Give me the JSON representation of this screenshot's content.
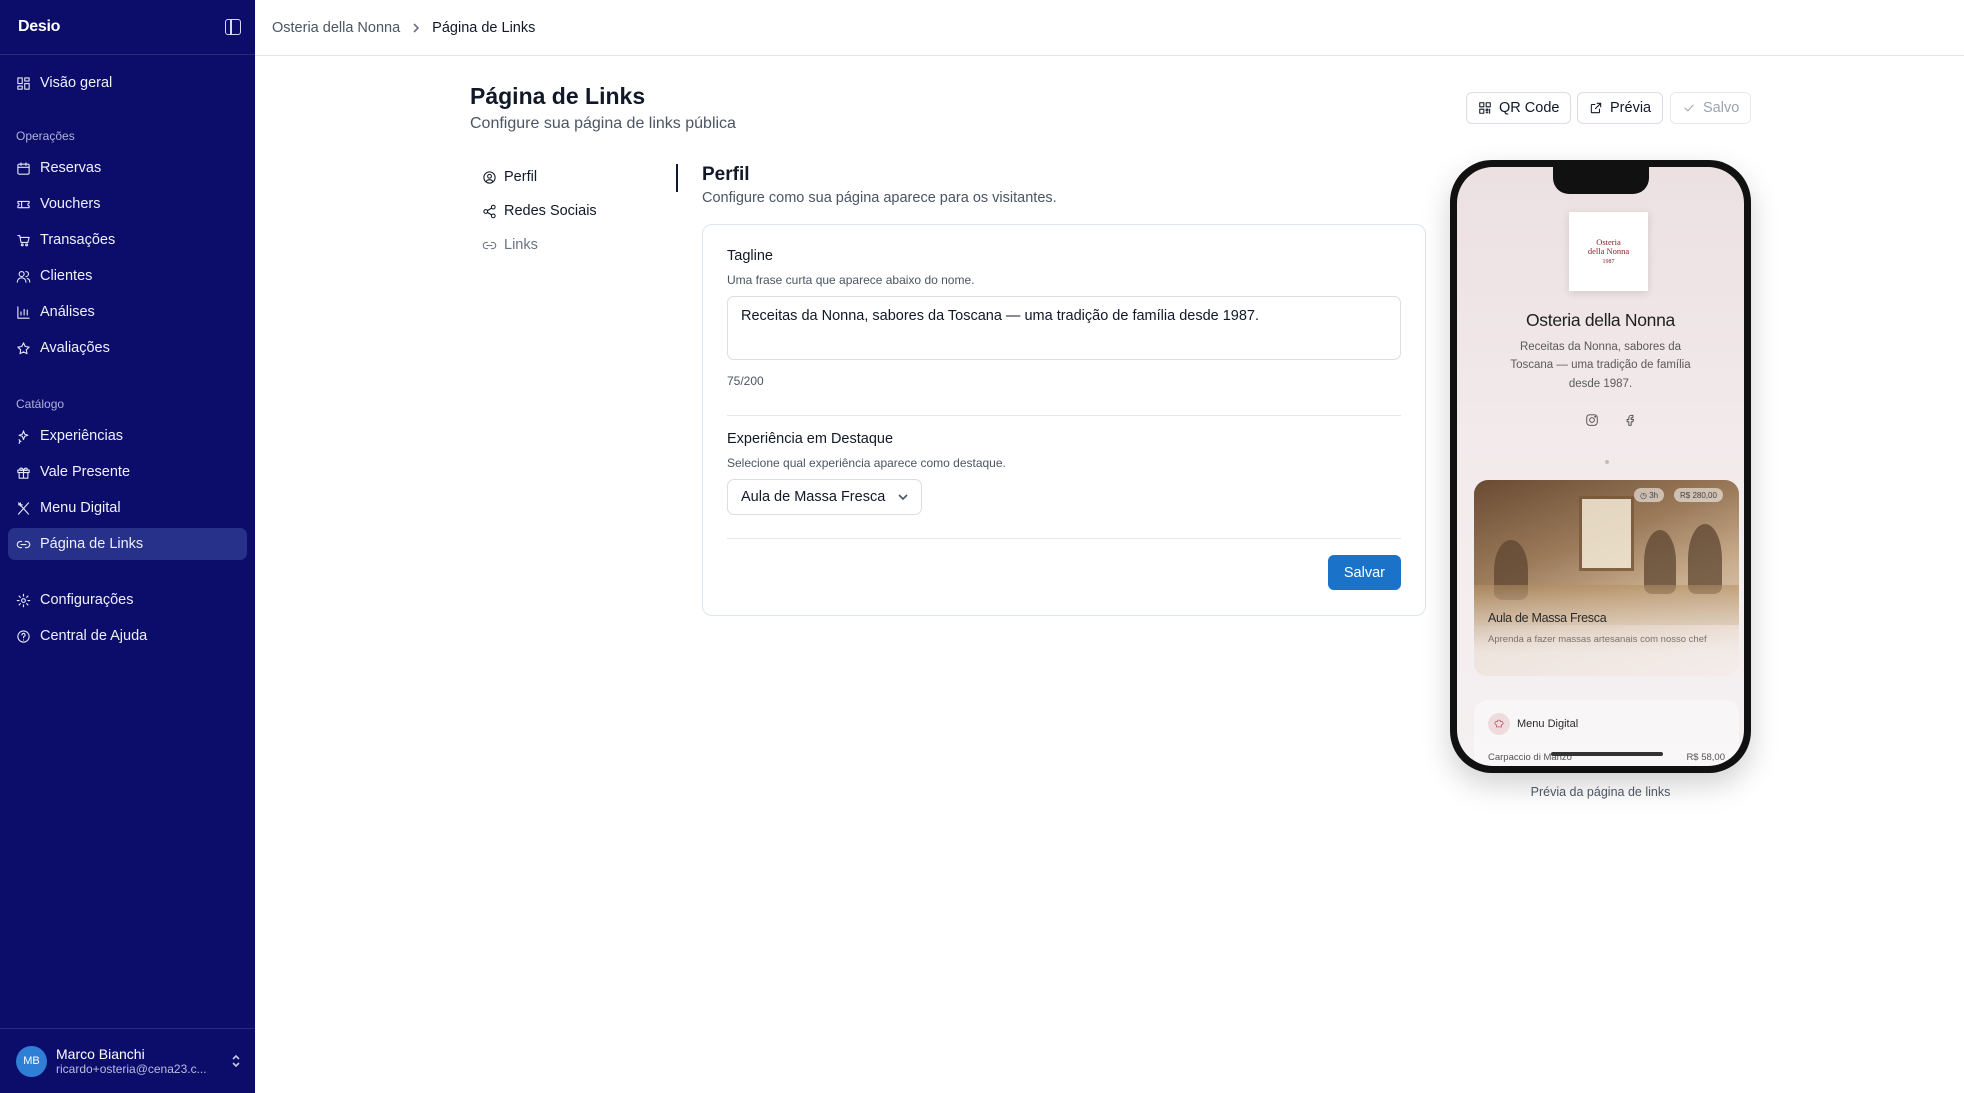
{
  "app": {
    "logo": "Desio"
  },
  "sidebar": {
    "top_item": {
      "label": "Visão geral",
      "icon": "dashboard-icon"
    },
    "sections": [
      {
        "label": "Operações",
        "items": [
          {
            "label": "Reservas",
            "icon": "calendar-icon"
          },
          {
            "label": "Vouchers",
            "icon": "ticket-icon"
          },
          {
            "label": "Transações",
            "icon": "cart-icon"
          },
          {
            "label": "Clientes",
            "icon": "users-icon"
          },
          {
            "label": "Análises",
            "icon": "bar-chart-icon"
          },
          {
            "label": "Avaliações",
            "icon": "star-icon"
          }
        ]
      },
      {
        "label": "Catálogo",
        "items": [
          {
            "label": "Experiências",
            "icon": "sparkles-icon"
          },
          {
            "label": "Vale Presente",
            "icon": "gift-icon"
          },
          {
            "label": "Menu Digital",
            "icon": "utensils-icon"
          },
          {
            "label": "Página de Links",
            "icon": "link-icon",
            "active": true
          }
        ]
      }
    ],
    "bottom_items": [
      {
        "label": "Configurações",
        "icon": "gear-icon"
      },
      {
        "label": "Central de Ajuda",
        "icon": "help-circle-icon"
      }
    ],
    "user": {
      "initials": "MB",
      "name": "Marco Bianchi",
      "email": "ricardo+osteria@cena23.c..."
    }
  },
  "breadcrumb": {
    "parent": "Osteria della Nonna",
    "current": "Página de Links"
  },
  "header": {
    "title": "Página de Links",
    "subtitle": "Configure sua página de links pública",
    "qr_label": "QR Code",
    "preview_label": "Prévia",
    "saved_label": "Salvo"
  },
  "subnav": [
    {
      "label": "Perfil",
      "icon": "user-circle-icon"
    },
    {
      "label": "Redes Sociais",
      "icon": "share-icon"
    },
    {
      "label": "Links",
      "icon": "link-icon"
    }
  ],
  "profile": {
    "title": "Perfil",
    "subtitle": "Configure como sua página aparece para os visitantes.",
    "tagline_label": "Tagline",
    "tagline_help": "Uma frase curta que aparece abaixo do nome.",
    "tagline_value": "Receitas da Nonna, sabores da Toscana — uma tradição de família desde 1987.",
    "tagline_counter": "75/200",
    "featured_label": "Experiência em Destaque",
    "featured_help": "Selecione qual experiência aparece como destaque.",
    "featured_value": "Aula de Massa Fresca",
    "save_label": "Salvar"
  },
  "preview": {
    "logo_line1": "Osteria",
    "logo_line2": "della Nonna",
    "logo_line3": "1987",
    "name": "Osteria della Nonna",
    "tagline": "Receitas da Nonna, sabores da Toscana — uma tradição de família desde 1987.",
    "social_icons": [
      "instagram-icon",
      "facebook-icon"
    ],
    "featured": {
      "duration": "3h",
      "price": "R$ 280,00",
      "title": "Aula de Massa Fresca",
      "description": "Aprenda a fazer massas artesanais com nosso chef"
    },
    "menu": {
      "title": "Menu Digital",
      "item": "Carpaccio di Manzo",
      "price": "R$ 58,00"
    },
    "caption": "Prévia da página de links"
  },
  "colors": {
    "sidebar": "#0c0c6b",
    "active": "#27318a",
    "primary": "#1a73c9"
  }
}
